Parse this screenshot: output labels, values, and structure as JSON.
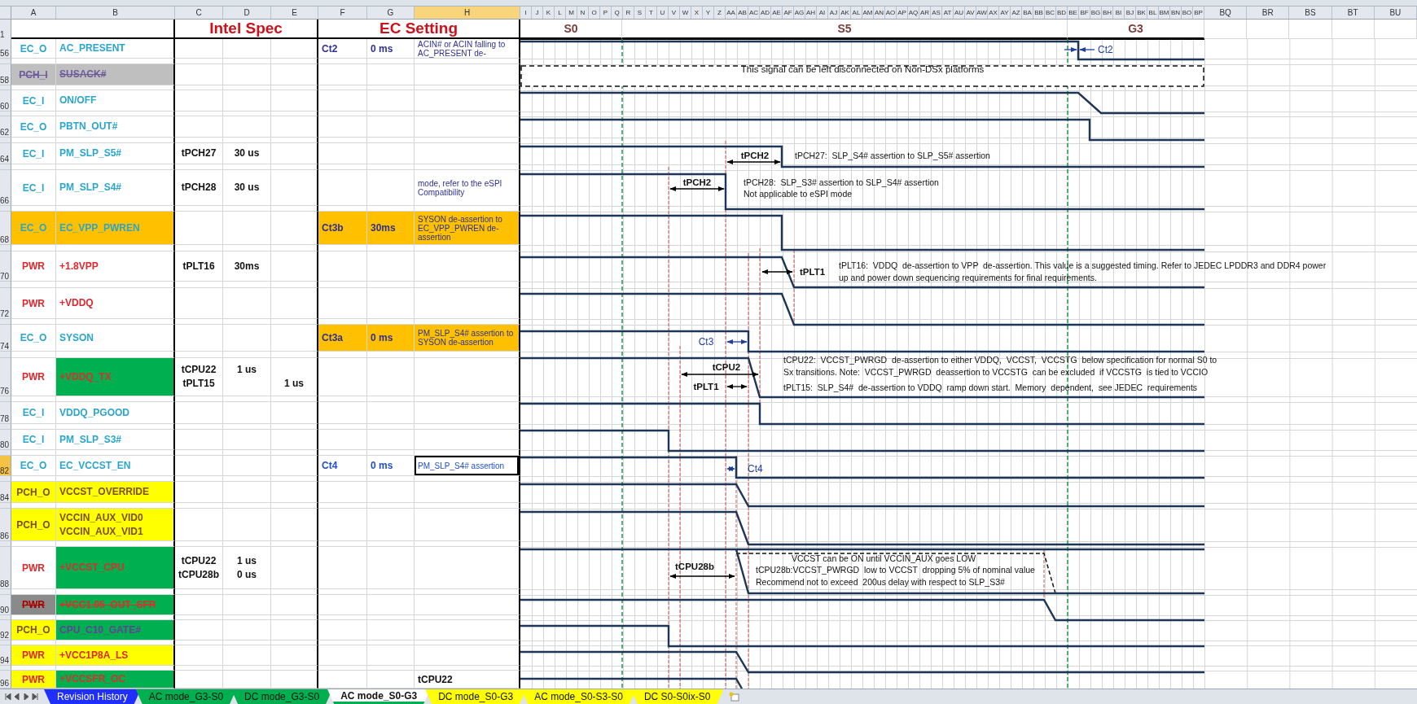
{
  "columns": [
    {
      "label": "A",
      "selected": false
    },
    {
      "label": "B",
      "selected": false
    },
    {
      "label": "C",
      "selected": false
    },
    {
      "label": "D",
      "selected": false
    },
    {
      "label": "E",
      "selected": false
    },
    {
      "label": "F",
      "selected": false
    },
    {
      "label": "G",
      "selected": false
    },
    {
      "label": "H",
      "selected": true
    }
  ],
  "timing_columns": [
    "I",
    "J",
    "K",
    "L",
    "M",
    "N",
    "O",
    "P",
    "Q",
    "R",
    "S",
    "T",
    "U",
    "V",
    "W",
    "X",
    "Y",
    "Z",
    "AA",
    "AB",
    "AC",
    "AD",
    "AE",
    "AF",
    "AG",
    "AH",
    "AI",
    "AJ",
    "AK",
    "AL",
    "AM",
    "AN",
    "AO",
    "AP",
    "AQ",
    "AR",
    "AS",
    "AT",
    "AU",
    "AV",
    "AW",
    "AX",
    "AY",
    "AZ",
    "BA",
    "BB",
    "BC",
    "BD",
    "BE",
    "BF",
    "BG",
    "BH",
    "BI",
    "BJ",
    "BK",
    "BL",
    "BM",
    "BN",
    "BO",
    "BP"
  ],
  "extra_columns": [
    "BQ",
    "BR",
    "BS",
    "BT",
    "BU"
  ],
  "title_row": {
    "number": "1",
    "sections": [
      "Intel Spec",
      "EC Setting"
    ],
    "phases": [
      "S0",
      "S5",
      "G3"
    ]
  },
  "rows": [
    {
      "number": "56",
      "selected": false,
      "struck": false,
      "type": {
        "text": "EC_O",
        "color": "#2aa5cc"
      },
      "signal": {
        "lines": [
          "AC_PRESENT"
        ],
        "color": "#2aa5cc"
      },
      "ec": {
        "kind": "setting",
        "name": "Ct2",
        "value": "0 ms",
        "note": "ACIN# or ACIN falling to AC_PRESENT de-",
        "color": "#2e3192"
      }
    },
    {
      "number": "58",
      "selected": false,
      "struck": true,
      "type": {
        "text": "PCH_I",
        "color": "#6f5a9a",
        "cell": {
          "color": "#bfbfbf"
        }
      },
      "signal": {
        "lines": [
          "SUSACK#"
        ],
        "color": "#6f5a9a",
        "cell": {
          "color": "#bfbfbf"
        }
      }
    },
    {
      "number": "60",
      "selected": false,
      "struck": false,
      "type": {
        "text": "EC_I",
        "color": "#2aa5cc"
      },
      "signal": {
        "lines": [
          "ON/OFF"
        ],
        "color": "#2aa5cc"
      }
    },
    {
      "number": "62",
      "selected": false,
      "struck": false,
      "type": {
        "text": "EC_O",
        "color": "#2aa5cc"
      },
      "signal": {
        "lines": [
          "PBTN_OUT#"
        ],
        "color": "#2aa5cc"
      }
    },
    {
      "number": "64",
      "selected": false,
      "struck": false,
      "type": {
        "text": "EC_I",
        "color": "#2aa5cc"
      },
      "signal": {
        "lines": [
          "PM_SLP_S5#"
        ],
        "color": "#2aa5cc"
      },
      "spec": [
        {
          "name": "tPCH27",
          "column_d": "30 us"
        }
      ]
    },
    {
      "number": "66",
      "selected": false,
      "struck": false,
      "type": {
        "text": "EC_I",
        "color": "#2aa5cc"
      },
      "signal": {
        "lines": [
          "PM_SLP_S4#"
        ],
        "color": "#2aa5cc"
      },
      "spec": [
        {
          "name": "tPCH28",
          "column_d": "30 us"
        }
      ],
      "ec": {
        "kind": "setting",
        "note": "mode, refer to the eSPI Compatibility"
      }
    },
    {
      "number": "68",
      "selected": false,
      "struck": false,
      "type": {
        "text": "EC_O",
        "color": "#2aa5cc",
        "cell": {
          "color": "#ffc000"
        }
      },
      "signal": {
        "lines": [
          "EC_VPP_PWREN"
        ],
        "color": "#2aa5cc",
        "cell": {
          "color": "#ffc000"
        }
      },
      "ec": {
        "kind": "setting",
        "name": "Ct3b",
        "value": "30ms",
        "note": "SYSON de-assertion to EC_VPP_PWREN de-assertion",
        "color": "#2e3192",
        "cell": {
          "color": "#ffc000"
        }
      }
    },
    {
      "number": "70",
      "selected": false,
      "struck": false,
      "type": {
        "text": "PWR",
        "color": "#e0262b"
      },
      "signal": {
        "lines": [
          "+1.8VPP"
        ],
        "color": "#e0262b"
      },
      "spec": [
        {
          "name": "tPLT16",
          "column_d": "30ms"
        }
      ]
    },
    {
      "number": "72",
      "selected": false,
      "struck": false,
      "type": {
        "text": "PWR",
        "color": "#e0262b"
      },
      "signal": {
        "lines": [
          "+VDDQ"
        ],
        "color": "#e0262b"
      }
    },
    {
      "number": "74",
      "selected": false,
      "struck": false,
      "type": {
        "text": "EC_O",
        "color": "#2aa5cc"
      },
      "signal": {
        "lines": [
          "SYSON"
        ],
        "color": "#2aa5cc"
      },
      "ec": {
        "kind": "setting",
        "name": "Ct3a",
        "value": "0 ms",
        "note": "PM_SLP_S4# assertion to SYSON de-assertion",
        "color": "#2e3192",
        "cell": {
          "color": "#ffc000"
        }
      }
    },
    {
      "number": "76",
      "selected": false,
      "struck": false,
      "type": {
        "text": "PWR",
        "color": "#e0262b"
      },
      "signal": {
        "lines": [
          "+VDDQ_TX"
        ],
        "color": "#d9302a",
        "cell": {
          "color": "#00b050"
        }
      },
      "spec": [
        {
          "name": "tCPU22",
          "column_d": "1 us"
        },
        {
          "name": "tPLT15",
          "column_e": "1 us"
        }
      ]
    },
    {
      "number": "78",
      "selected": false,
      "struck": false,
      "type": {
        "text": "EC_I",
        "color": "#2aa5cc"
      },
      "signal": {
        "lines": [
          "VDDQ_PGOOD"
        ],
        "color": "#2aa5cc"
      }
    },
    {
      "number": "80",
      "selected": false,
      "struck": false,
      "type": {
        "text": "EC_I",
        "color": "#2aa5cc"
      },
      "signal": {
        "lines": [
          "PM_SLP_S3#"
        ],
        "color": "#2aa5cc"
      }
    },
    {
      "number": "82",
      "selected": true,
      "struck": false,
      "type": {
        "text": "EC_O",
        "color": "#2aa5cc"
      },
      "signal": {
        "lines": [
          "EC_VCCST_EN"
        ],
        "color": "#2aa5cc"
      },
      "ec": {
        "kind": "setting",
        "name": "Ct4",
        "value": "0 ms",
        "note": "PM_SLP_S4# assertion",
        "color": "#1f4fd0"
      }
    },
    {
      "number": "84",
      "selected": false,
      "struck": false,
      "type": {
        "text": "PCH_O",
        "color": "#7f4c1c",
        "cell": {
          "color": "#ffff00"
        }
      },
      "signal": {
        "lines": [
          "VCCST_OVERRIDE"
        ],
        "color": "#7f4c1c",
        "cell": {
          "color": "#ffff00"
        }
      }
    },
    {
      "number": "86",
      "selected": false,
      "struck": false,
      "type": {
        "text": "PCH_O",
        "color": "#7f4c1c",
        "cell": {
          "color": "#ffff00"
        }
      },
      "signal": {
        "lines": [
          "VCCIN_AUX_VID0",
          "VCCIN_AUX_VID1"
        ],
        "color": "#7f4c1c",
        "cell": {
          "color": "#ffff00"
        }
      }
    },
    {
      "number": "88",
      "selected": false,
      "struck": false,
      "type": {
        "text": "PWR",
        "color": "#e0262b"
      },
      "signal": {
        "lines": [
          "+VCCST_CPU"
        ],
        "color": "#d9302a",
        "cell": {
          "color": "#00b050"
        }
      },
      "spec": [
        {
          "name": "tCPU22",
          "column_d": "1 us"
        },
        {
          "name": "tCPU28b",
          "column_d": "0 us"
        }
      ]
    },
    {
      "number": "90",
      "selected": false,
      "struck": true,
      "type": {
        "text": "PWR",
        "color": "#a80000",
        "cell": {
          "color": "#8a8a8a"
        }
      },
      "signal": {
        "lines": [
          "+VCC1.05_OUT_SFR"
        ],
        "color": "#d9302a",
        "cell": {
          "color": "#00b050"
        }
      }
    },
    {
      "number": "92",
      "selected": false,
      "struck": false,
      "type": {
        "text": "PCH_O",
        "color": "#7f4c1c",
        "cell": {
          "color": "#ffff00"
        }
      },
      "signal": {
        "lines": [
          "CPU_C10_GATE#"
        ],
        "color": "#6a3d9a",
        "cell": {
          "color": "#00b050"
        }
      }
    },
    {
      "number": "94",
      "selected": false,
      "struck": false,
      "type": {
        "text": "PWR",
        "color": "#e0262b",
        "cell": {
          "color": "#ffff00"
        }
      },
      "signal": {
        "lines": [
          "+VCC1P8A_LS"
        ],
        "color": "#e0262b",
        "cell": {
          "color": "#ffff00"
        }
      }
    },
    {
      "number": "96",
      "selected": false,
      "struck": false,
      "type": {
        "text": "PWR",
        "color": "#e0262b",
        "cell": {
          "color": "#ffff00"
        }
      },
      "signal": {
        "lines": [
          "+VCCSFR_OC"
        ],
        "color": "#d9302a",
        "cell": {
          "color": "#00b050"
        }
      },
      "ec": {
        "kind": "label",
        "note": "tCPU22"
      }
    }
  ],
  "diagram": {
    "box_note": "This signal can be left disconnected on Non-DSx platforms",
    "labels": [
      {
        "text": "Ct2",
        "kind": "ec"
      },
      {
        "text": "tPCH2",
        "kind": "spec"
      },
      {
        "text": "tPCH2",
        "kind": "spec"
      },
      {
        "text": "tPLT1",
        "kind": "spec"
      },
      {
        "text": "Ct3",
        "kind": "ec"
      },
      {
        "text": "tCPU2",
        "kind": "spec"
      },
      {
        "text": "tPLT1",
        "kind": "spec"
      },
      {
        "text": "Ct4",
        "kind": "ec"
      },
      {
        "text": "tCPU28b",
        "kind": "spec"
      }
    ],
    "notes": [
      "tPCH27:  SLP_S4# assertion to SLP_S5# assertion",
      "tPCH28:  SLP_S3# assertion to SLP_S4# assertion",
      "Not applicable to eSPI mode",
      "tPLT16:  VDDQ  de-assertion to VPP  de-assertion. This value is a suggested timing. Refer to JEDEC LPDDR3 and DDR4 power",
      "up and power down sequencing requirements for final requirements.",
      "tCPU22:  VCCST_PWRGD  de-assertion to either VDDQ,  VCCST,  VCCSTG  below specification for normal S0 to",
      "Sx transitions. Note:  VCCST_PWRGD  deassertion to VCCSTG  can be excluded  if VCCSTG  is tied to VCCIO",
      "tPLT15:  SLP_S4#  de-assertion to VDDQ  ramp down start.  Memory  dependent,  see JEDEC  requirements",
      "VCCST can be ON until VCCIN_AUX goes LOW",
      "tCPU28b:VCCST_PWRGD  low to VCCST  dropping 5% of nominal value",
      "Recommend not to exceed  200us delay with respect to SLP_S3#"
    ]
  },
  "tabs": [
    {
      "label": "Revision History",
      "color": "#1f2fff",
      "selected": false
    },
    {
      "label": "AC mode_G3-S0",
      "color": "#00b050",
      "selected": false
    },
    {
      "label": "DC mode_G3-S0",
      "color": "#00b050",
      "selected": false
    },
    {
      "label": "AC mode_S0-G3",
      "color": "#00b050",
      "selected": true
    },
    {
      "label": "DC mode_S0-G3",
      "color": "#ffff00",
      "selected": false
    },
    {
      "label": "AC mode_S0-S3-S0",
      "color": "#ffff00",
      "selected": false
    },
    {
      "label": "DC S0-S0ix-S0",
      "color": "#ffff00",
      "selected": false
    }
  ]
}
